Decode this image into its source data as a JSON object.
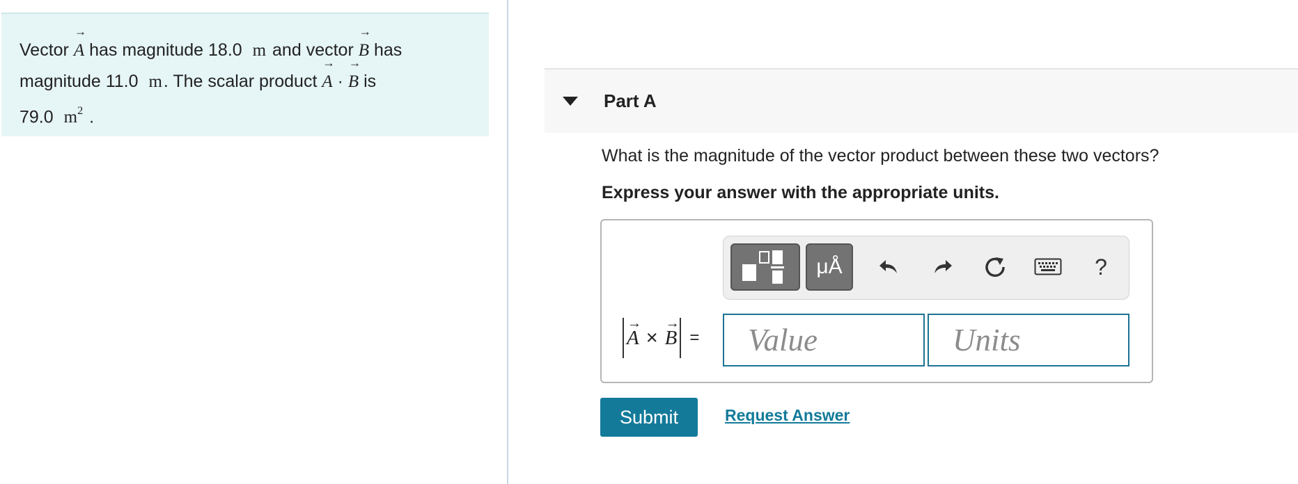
{
  "problem": {
    "prefix": "Vector",
    "vector_a": "A",
    "text_1": "has magnitude 18.0",
    "unit_m": "m",
    "text_2": "and vector",
    "vector_b": "B",
    "text_3": "has",
    "text_4": "magnitude 11.0",
    "text_5": ". The scalar product",
    "dot": "·",
    "text_6": "is",
    "text_7": "79.0",
    "unit_m2_base": "m",
    "unit_m2_exp": "2",
    "end": "."
  },
  "part": {
    "title": "Part A",
    "question": "What is the magnitude of the vector product between these two vectors?",
    "instruction": "Express your answer with the appropriate units."
  },
  "toolbar": {
    "units_label": "μÅ",
    "help_label": "?",
    "icons": [
      "templates-icon",
      "undo-icon",
      "redo-icon",
      "reset-icon",
      "keyboard-icon",
      "help-icon"
    ]
  },
  "formula": {
    "a": "A",
    "times": "×",
    "b": "B",
    "equals": "="
  },
  "answer": {
    "value_placeholder": "Value",
    "value": "",
    "units_placeholder": "Units",
    "units": ""
  },
  "actions": {
    "submit_label": "Submit",
    "request_answer_label": "Request Answer"
  },
  "colors": {
    "accent": "#137a9a",
    "problem_bg": "#e6f5f6"
  }
}
